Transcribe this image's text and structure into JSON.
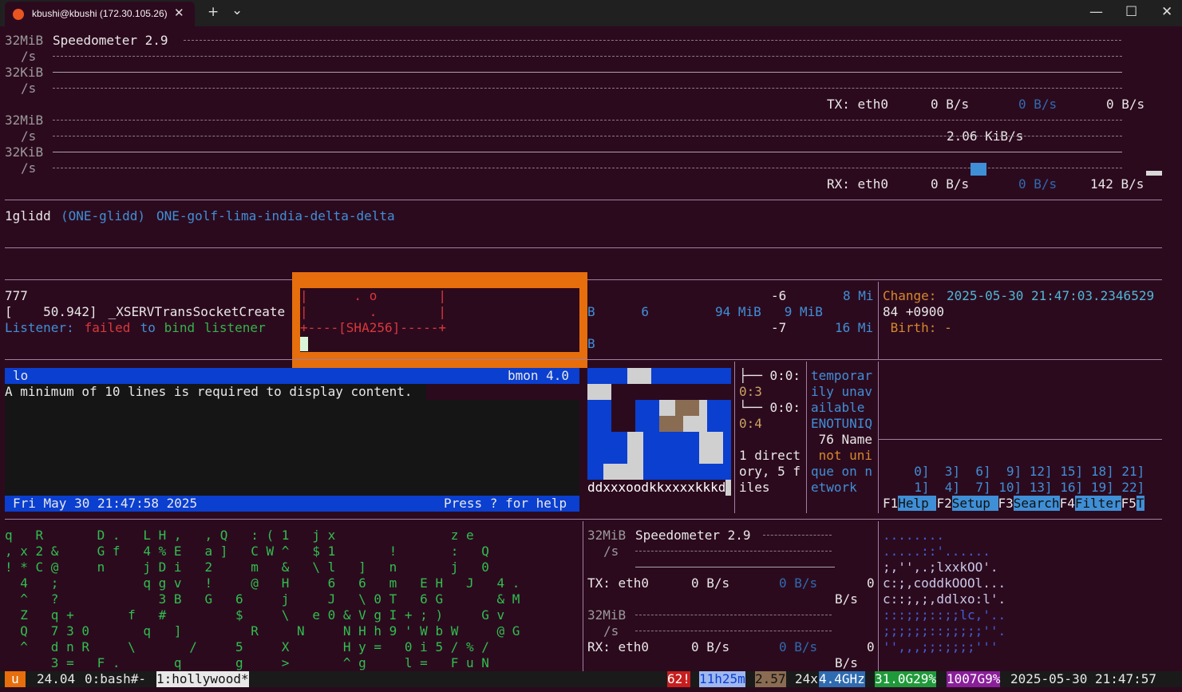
{
  "window": {
    "tab_title": "kbushi@kbushi (172.30.105.26)",
    "new_tab": "+",
    "tab_menu": "⌄",
    "minimize": "—",
    "maximize": "☐",
    "close": "✕"
  },
  "bmon_top": {
    "y32mib": "32MiB",
    "ys1": "/s",
    "y32kib": "32KiB",
    "ys2": "/s",
    "title": "Speedometer 2.9",
    "tx_label": "TX: eth0",
    "tx_v1": "0 B/s",
    "tx_v2": "0 B/s",
    "tx_v3": "0 B/s",
    "y32mib2": "32MiB",
    "ys3": "/s",
    "y32kib2": "32KiB",
    "ys4": "/s",
    "rx_mid": "2.06 KiB/s",
    "rx_label": "RX: eth0",
    "rx_v1": "0 B/s",
    "rx_v2": "0 B/s",
    "rx_v3": "142 B/s"
  },
  "host": {
    "id": "1glidd",
    "paren": "(ONE-glidd)",
    "full": "ONE-golf-lima-india-delta-delta"
  },
  "mid": {
    "l1": "777",
    "l2a": "[    50.942]",
    "l2b": " _XSERVTransSocketCreate",
    "l3a": "Listener:",
    "l3b": " failed",
    "l3c": " to",
    "l3d": " bind",
    "l3e": " listener",
    "sha1": "|      . o        |",
    "sha2": "|        .        |",
    "sha3": "+----[SHA256]-----+",
    "r1a": "-6",
    "r1b": "8 Mi",
    "r2a": "B      6",
    "r2b": "94 MiB   9 MiB",
    "r3a": "-7",
    "r3b": "16 Mi",
    "r4": "B",
    "change_label": "Change:",
    "change_val": "2025-05-30 21:47:03.2346529",
    "tz": "84 +0900",
    "birth": " Birth: -"
  },
  "bmon_pane": {
    "iface": "lo",
    "version": "bmon 4.0",
    "msg": "A minimum of 10 lines is required to display content.",
    "date": "Fri May 30 21:47:58 2025",
    "help": "Press ? for help"
  },
  "ascii_art": {
    "bottom": "ddxxxoodkkxxxxkkkd"
  },
  "tree": {
    "t1": "├── 0:0:",
    "t2": "0:3",
    "t3": "└── 0:0:",
    "t4": "0:4",
    "t5": "1 direct",
    "t6": "ory, 5 f",
    "t7": "iles"
  },
  "err": {
    "e1": "temporar",
    "e2": "ily unav",
    "e3": "ailable",
    "e4": "ENOTUNIQ",
    "e5": " 76 Name",
    "e6": " not uni",
    "e7": "que on n",
    "e8": "etwork"
  },
  "htop": {
    "row1": "  0]  3]  6]  9] 12] 15] 18] 21]",
    "row2": "  1]  4]  7] 10] 13] 16] 19] 22]",
    "keys": [
      [
        "F1",
        "Help  "
      ],
      [
        "F2",
        "Setup "
      ],
      [
        "F3",
        "Search"
      ],
      [
        "F4",
        "Filter"
      ],
      [
        "F5",
        "T"
      ]
    ]
  },
  "matrix": [
    "q   R       D .   L H ,   , Q   : ( 1   j x               z e",
    ", x 2 &     G f   4 % E   a ]   C W ^   $ 1       !       :   Q",
    "! * C @     n     j D i   2     m   &   \\ l   ]   n       j   0",
    "  4   ;           q g v   !     @   H     6   6   m   E H   J   4 .",
    "  ^   ?             3 B   G   6     j     J   \\ 0 T   6 G       & M",
    "  Z   q +       f   #         $     \\   e 0 & V g I + ; )     G v",
    "  Q   7 3 0       q   ]         R     N     N H h 9 ' W b W     @ G",
    "  ^   d n R     \\       /     5     X       H y =   0 i 5 / % /",
    "      3 =   F .       q       g     >       ^ g     l =   F u N"
  ],
  "speed2": {
    "y1": "32MiB",
    "s1": "/s",
    "title": "Speedometer 2.9",
    "tx": "TX: eth0",
    "tx1": "0 B/s",
    "tx2": "0 B/s",
    "tx3": "0",
    "bs1": "B/s",
    "y2": "32MiB",
    "s2": "/s",
    "rx": "RX: eth0",
    "rx1": "0 B/s",
    "rx2": "0 B/s",
    "rx3": "0",
    "bs2": "B/s"
  },
  "ascii2": [
    "........",
    ".....::'......",
    ";,'',.;lxxkOO'.",
    "c:;,coddkOOOl...",
    "c::;,;,ddlxo:l'.",
    ":::;;;::;;lc,'..",
    ";;;;;;::;;;;;''.",
    "'',,,;;:;;;;'''"
  ],
  "status": {
    "session": "u",
    "ver": "24.04",
    "win0": "0:bash#-",
    "win1": "1:hollywood*",
    "n62": "62!",
    "uptime": "11h25m",
    "load": "2.57",
    "cpu": "24x",
    "ghz": "4.4GHz",
    "mem": "31.0G29%",
    "disk": "1007G9%",
    "clock": "2025-05-30 21:47:57"
  }
}
